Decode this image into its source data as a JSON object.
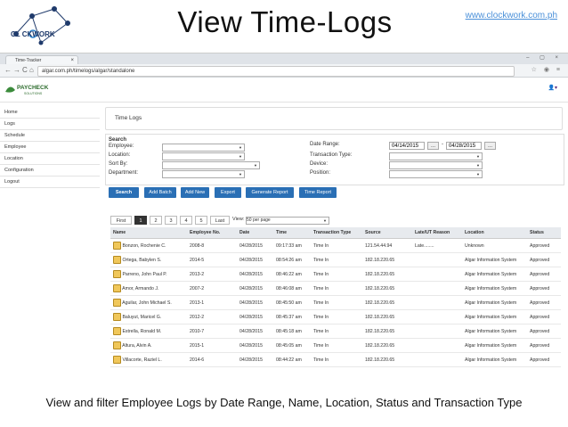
{
  "slide": {
    "title": "View Time-Logs",
    "url": "www.clockwork.com.ph",
    "logo_text": "CL   CKWORK",
    "caption": "View and filter Employee Logs by Date Range, Name, Location, Status and Transaction Type"
  },
  "browser": {
    "tab_title": "Time-Tracker",
    "tab_close": "×",
    "address": "algar.com.ph/timelogs/algar/standalone",
    "nav": {
      "back": "←",
      "forward": "→",
      "reload": "C",
      "home": "⌂"
    },
    "window_controls": "– ▢ ×"
  },
  "app": {
    "brand": "PAYCHECK",
    "brand_sub": "SOLUTIONS",
    "user_icon": "user-icon",
    "sidebar": [
      "Home",
      "Logs",
      "Schedule",
      "Employee",
      "Location",
      "Configuration",
      "Logout"
    ],
    "panel_title": "Time Logs",
    "search": {
      "heading": "Search",
      "employee_label": "Employee:",
      "location_label": "Location:",
      "sortby_label": "Sort By:",
      "department_label": "Department:",
      "daterange_label": "Date Range:",
      "transtype_label": "Transaction Type:",
      "device_label": "Device:",
      "position_label": "Position:",
      "date_from": "04/14/2015",
      "date_to": "04/28/2015",
      "date_sep": "-",
      "picker_label": "..."
    },
    "buttons": [
      "Search",
      "Add Batch",
      "Add New",
      "Export",
      "Generate Report",
      "Time Report"
    ],
    "pager": {
      "first": "First",
      "pages": [
        "1",
        "2",
        "3",
        "4",
        "5"
      ],
      "last": "Last",
      "view_label": "View:",
      "view_value": "50 per page"
    },
    "table": {
      "columns": [
        "Name",
        "Employee No.",
        "Date",
        "Time",
        "Transaction Type",
        "Source",
        "Late/UT Reason",
        "Location",
        "Status"
      ],
      "rows": [
        [
          "Bonzon, Rochenie C.",
          "2008-8",
          "04/28/2015",
          "09:17:33 am",
          "Time In",
          "121.54.44.94",
          "Late........",
          "Unknown",
          "Approved"
        ],
        [
          "Ortega, Babylen S.",
          "2014-5",
          "04/28/2015",
          "08:54:26 am",
          "Time In",
          "182.18.220.65",
          "",
          "Algar Information System",
          "Approved"
        ],
        [
          "Parreno, John Paul P.",
          "2013-2",
          "04/28/2015",
          "08:46:22 am",
          "Time In",
          "182.18.220.65",
          "",
          "Algar Information System",
          "Approved"
        ],
        [
          "Amor, Armando J.",
          "2007-2",
          "04/28/2015",
          "08:46:08 am",
          "Time In",
          "182.18.220.65",
          "",
          "Algar Information System",
          "Approved"
        ],
        [
          "Aguilar, John Michael S.",
          "2013-1",
          "04/28/2015",
          "08:45:50 am",
          "Time In",
          "182.18.220.65",
          "",
          "Algar Information System",
          "Approved"
        ],
        [
          "Baluyut, Maricel G.",
          "2012-2",
          "04/28/2015",
          "08:45:37 am",
          "Time In",
          "182.18.220.65",
          "",
          "Algar Information System",
          "Approved"
        ],
        [
          "Estrella, Ronald M.",
          "2010-7",
          "04/28/2015",
          "08:45:18 am",
          "Time In",
          "182.18.220.65",
          "",
          "Algar Information System",
          "Approved"
        ],
        [
          "Altura, Alvin A.",
          "2015-1",
          "04/28/2015",
          "08:45:05 am",
          "Time In",
          "182.18.220.65",
          "",
          "Algar Information System",
          "Approved"
        ],
        [
          "Villacorte, Raziel L.",
          "2014-6",
          "04/28/2015",
          "08:44:22 am",
          "Time In",
          "182.18.220.65",
          "",
          "Algar Information System",
          "Approved"
        ]
      ]
    }
  }
}
